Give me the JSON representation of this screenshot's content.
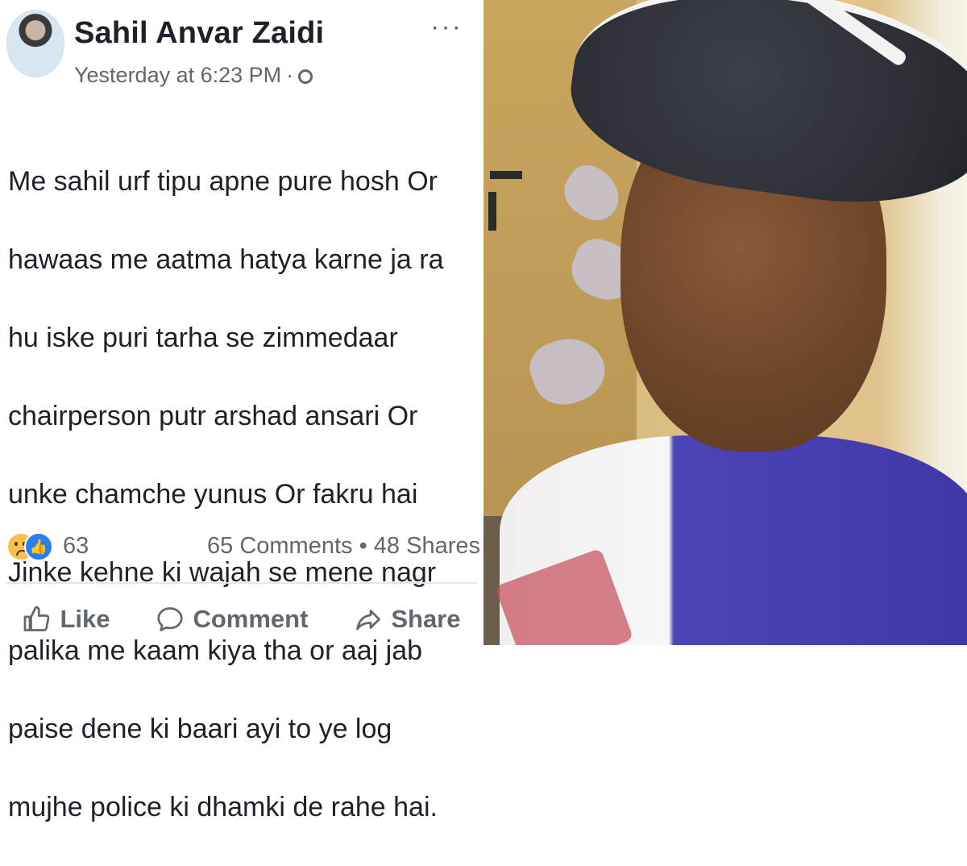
{
  "post": {
    "author": "Sahil Anvar Zaidi",
    "timestamp": "Yesterday at 6:23 PM",
    "meta_separator": "·",
    "privacy_icon": "globe-icon",
    "more_options": "···",
    "message_lines": [
      "Me sahil urf tipu apne pure hosh Or",
      "hawaas me aatma hatya karne ja ra",
      "hu iske puri tarha se zimmedaar",
      "chairperson putr arshad ansari Or",
      "unke chamche yunus Or fakru hai",
      "Jinke kehne ki wajah se mene nagr",
      "palika me kaam kiya tha or aaj jab",
      "paise dene ki baari ayi to ye log",
      "mujhe police ki dhamki de rahe hai."
    ],
    "reactions": {
      "icons": [
        "sad-reaction-icon",
        "like-reaction-icon"
      ],
      "count": "63"
    },
    "comments_shares": "65 Comments • 48 Shares",
    "actions": {
      "like": "Like",
      "comment": "Comment",
      "share": "Share"
    }
  },
  "colors": {
    "text": "#1d2129",
    "secondary": "#606770",
    "like_blue": "#2a7ef1",
    "divider": "#e4e6eb"
  }
}
